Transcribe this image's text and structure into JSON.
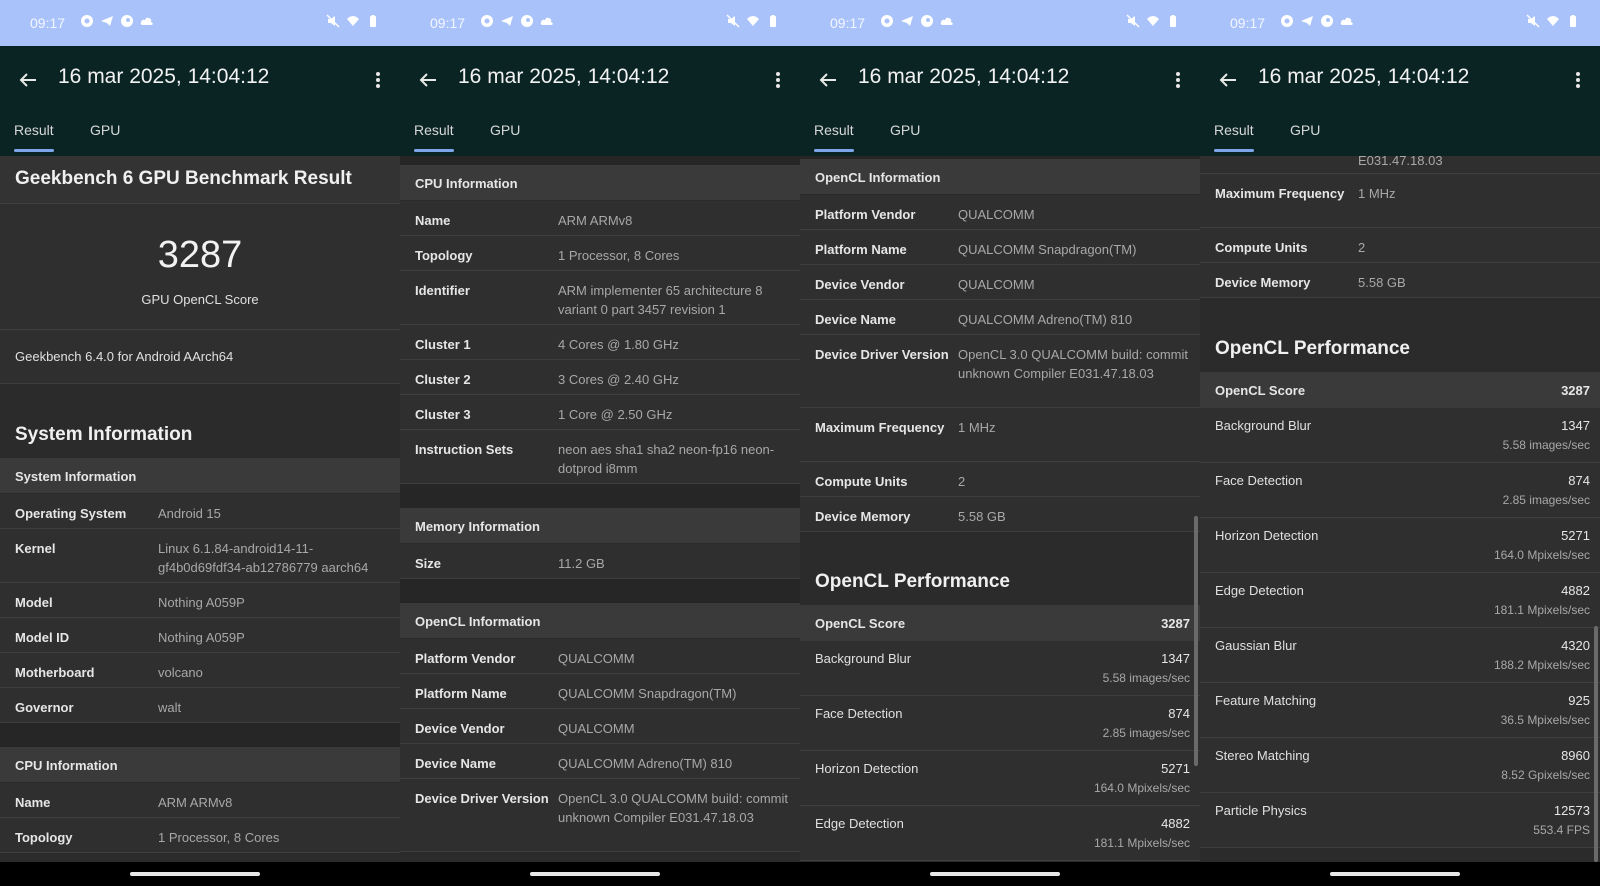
{
  "status": {
    "time": "09:17",
    "left_icons": [
      "chat-bubble-icon",
      "telegram-icon",
      "steam-icon",
      "cloud-icon"
    ],
    "right_icons": [
      "mute-icon",
      "wifi-icon",
      "battery-icon"
    ]
  },
  "appbar": {
    "title": "16 mar 2025, 14:04:12",
    "tabs": [
      "Result",
      "GPU"
    ]
  },
  "screen1": {
    "header_title": "Geekbench 6 GPU Benchmark Result",
    "score": "3287",
    "score_label": "GPU OpenCL Score",
    "version": "Geekbench 6.4.0 for Android AArch64",
    "system_title": "System Information",
    "system_head": "System Information",
    "system_rows": [
      {
        "k": "Operating System",
        "v": "Android 15"
      },
      {
        "k": "Kernel",
        "v": "Linux 6.1.84-android14-11-gf4b0d69fdf34-ab12786779 aarch64"
      },
      {
        "k": "Model",
        "v": "Nothing A059P"
      },
      {
        "k": "Model ID",
        "v": "Nothing A059P"
      },
      {
        "k": "Motherboard",
        "v": "volcano"
      },
      {
        "k": "Governor",
        "v": "walt"
      }
    ],
    "cpu_head": "CPU Information",
    "cpu_rows": [
      {
        "k": "Name",
        "v": "ARM ARMv8"
      },
      {
        "k": "Topology",
        "v": "1 Processor, 8 Cores"
      }
    ]
  },
  "screen2": {
    "cpu_head": "CPU Information",
    "cpu_rows": [
      {
        "k": "Name",
        "v": "ARM ARMv8"
      },
      {
        "k": "Topology",
        "v": "1 Processor, 8 Cores"
      },
      {
        "k": "Identifier",
        "v": "ARM implementer 65 architecture 8 variant 0 part 3457 revision 1"
      },
      {
        "k": "Cluster 1",
        "v": "4 Cores @ 1.80 GHz"
      },
      {
        "k": "Cluster 2",
        "v": "3 Cores @ 2.40 GHz"
      },
      {
        "k": "Cluster 3",
        "v": "1 Core @ 2.50 GHz"
      },
      {
        "k": "Instruction Sets",
        "v": "neon aes sha1 sha2 neon-fp16 neon-dotprod i8mm"
      }
    ],
    "mem_head": "Memory Information",
    "mem_rows": [
      {
        "k": "Size",
        "v": "11.2 GB"
      }
    ],
    "ocl_head": "OpenCL Information",
    "ocl_rows": [
      {
        "k": "Platform Vendor",
        "v": "QUALCOMM"
      },
      {
        "k": "Platform Name",
        "v": "QUALCOMM Snapdragon(TM)"
      },
      {
        "k": "Device Vendor",
        "v": "QUALCOMM"
      },
      {
        "k": "Device Name",
        "v": "QUALCOMM Adreno(TM) 810"
      },
      {
        "k": "Device Driver Version",
        "v": "OpenCL 3.0 QUALCOMM build: commit unknown Compiler E031.47.18.03"
      }
    ]
  },
  "screen3": {
    "ocl_head": "OpenCL Information",
    "ocl_rows": [
      {
        "k": "Platform Vendor",
        "v": "QUALCOMM"
      },
      {
        "k": "Platform Name",
        "v": "QUALCOMM Snapdragon(TM)"
      },
      {
        "k": "Device Vendor",
        "v": "QUALCOMM"
      },
      {
        "k": "Device Name",
        "v": "QUALCOMM Adreno(TM) 810"
      },
      {
        "k": "Device Driver Version",
        "v": "OpenCL 3.0 QUALCOMM build: commit unknown Compiler E031.47.18.03"
      },
      {
        "k": "Maximum Frequency",
        "v": "1 MHz"
      },
      {
        "k": "Compute Units",
        "v": "2"
      },
      {
        "k": "Device Memory",
        "v": "5.58 GB"
      }
    ],
    "perf_title": "OpenCL Performance",
    "score_label": "OpenCL Score",
    "score": "3287",
    "perf_rows": [
      {
        "k": "Background Blur",
        "s": "1347",
        "u": "5.58 images/sec"
      },
      {
        "k": "Face Detection",
        "s": "874",
        "u": "2.85 images/sec"
      },
      {
        "k": "Horizon Detection",
        "s": "5271",
        "u": "164.0 Mpixels/sec"
      },
      {
        "k": "Edge Detection",
        "s": "4882",
        "u": "181.1 Mpixels/sec"
      }
    ]
  },
  "screen4": {
    "partial_value": "E031.47.18.03",
    "ocl_rows": [
      {
        "k": "Maximum Frequency",
        "v": "1 MHz"
      },
      {
        "k": "Compute Units",
        "v": "2"
      },
      {
        "k": "Device Memory",
        "v": "5.58 GB"
      }
    ],
    "perf_title": "OpenCL Performance",
    "score_label": "OpenCL Score",
    "score": "3287",
    "perf_rows": [
      {
        "k": "Background Blur",
        "s": "1347",
        "u": "5.58 images/sec"
      },
      {
        "k": "Face Detection",
        "s": "874",
        "u": "2.85 images/sec"
      },
      {
        "k": "Horizon Detection",
        "s": "5271",
        "u": "164.0 Mpixels/sec"
      },
      {
        "k": "Edge Detection",
        "s": "4882",
        "u": "181.1 Mpixels/sec"
      },
      {
        "k": "Gaussian Blur",
        "s": "4320",
        "u": "188.2 Mpixels/sec"
      },
      {
        "k": "Feature Matching",
        "s": "925",
        "u": "36.5 Mpixels/sec"
      },
      {
        "k": "Stereo Matching",
        "s": "8960",
        "u": "8.52 Gpixels/sec"
      },
      {
        "k": "Particle Physics",
        "s": "12573",
        "u": "553.4 FPS"
      }
    ]
  }
}
